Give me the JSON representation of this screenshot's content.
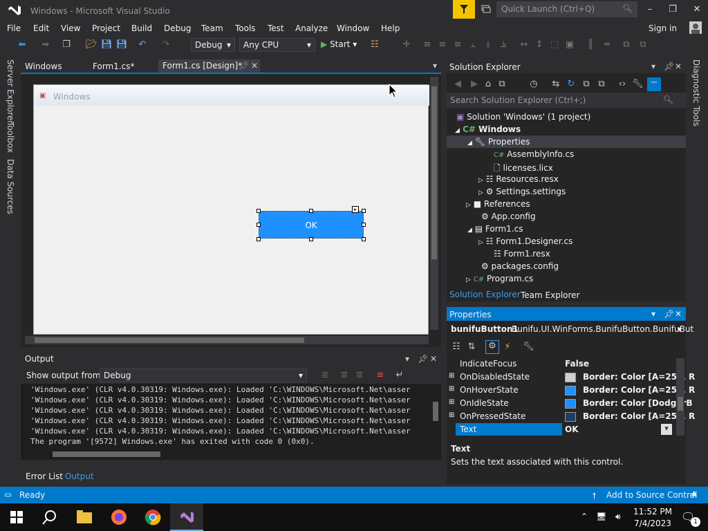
{
  "window": {
    "title": "Windows - Microsoft Visual Studio",
    "quick_launch_placeholder": "Quick Launch (Ctrl+Q)",
    "signin": "Sign in"
  },
  "menu": [
    "File",
    "Edit",
    "View",
    "Project",
    "Build",
    "Debug",
    "Team",
    "Tools",
    "Test",
    "Analyze",
    "Window",
    "Help"
  ],
  "toolbar": {
    "config": "Debug",
    "platform": "Any CPU",
    "start": "Start"
  },
  "leftrail": [
    "Server Explorer",
    "Toolbox",
    "Data Sources"
  ],
  "rightrail": "Diagnostic Tools",
  "doctabs": [
    "Windows",
    "Form1.cs*",
    "Form1.cs [Design]*"
  ],
  "designer": {
    "form_title": "Windows",
    "button_text": "OK"
  },
  "output": {
    "title": "Output",
    "show_from_label": "Show output from:",
    "show_from_value": "Debug",
    "lines": [
      "'Windows.exe' (CLR v4.0.30319: Windows.exe): Loaded 'C:\\WINDOWS\\Microsoft.Net\\asser",
      "'Windows.exe' (CLR v4.0.30319: Windows.exe): Loaded 'C:\\WINDOWS\\Microsoft.Net\\asser",
      "'Windows.exe' (CLR v4.0.30319: Windows.exe): Loaded 'C:\\WINDOWS\\Microsoft.Net\\asser",
      "'Windows.exe' (CLR v4.0.30319: Windows.exe): Loaded 'C:\\WINDOWS\\Microsoft.Net\\asser",
      "'Windows.exe' (CLR v4.0.30319: Windows.exe): Loaded 'C:\\WINDOWS\\Microsoft.Net\\asser",
      "The program '[9572] Windows.exe' has exited with code 0 (0x0)."
    ]
  },
  "bottomtabs": [
    "Error List",
    "Output"
  ],
  "solution_explorer": {
    "title": "Solution Explorer",
    "search_placeholder": "Search Solution Explorer (Ctrl+;)",
    "nodes": [
      {
        "label": "Solution 'Windows' (1 project)",
        "icon": "solution-icon"
      },
      {
        "label": "Windows",
        "icon": "csharp-project-icon"
      },
      {
        "label": "Properties",
        "icon": "wrench-icon"
      },
      {
        "label": "AssemblyInfo.cs",
        "icon": "csharp-file-icon"
      },
      {
        "label": "licenses.licx",
        "icon": "file-icon"
      },
      {
        "label": "Resources.resx",
        "icon": "resx-icon"
      },
      {
        "label": "Settings.settings",
        "icon": "gear-icon"
      },
      {
        "label": "References",
        "icon": "references-icon"
      },
      {
        "label": "App.config",
        "icon": "config-icon"
      },
      {
        "label": "Form1.cs",
        "icon": "form-icon"
      },
      {
        "label": "Form1.Designer.cs",
        "icon": "csharp-file-icon"
      },
      {
        "label": "Form1.resx",
        "icon": "resx-icon"
      },
      {
        "label": "packages.config",
        "icon": "config-icon"
      },
      {
        "label": "Program.cs",
        "icon": "csharp-file-icon"
      }
    ],
    "tabs": [
      "Solution Explorer",
      "Team Explorer"
    ]
  },
  "properties": {
    "title": "Properties",
    "object_name": "bunifuButton1",
    "object_type": "Bunifu.UI.WinForms.BunifuButton.BunifuBut",
    "rows": [
      {
        "name": "IndicateFocus",
        "value": "False"
      },
      {
        "name": "OnDisabledState",
        "value": "Border: Color [A=255, R",
        "swatch": "#d0d0d0"
      },
      {
        "name": "OnHoverState",
        "value": "Border: Color [A=255, R",
        "swatch": "#1e90ff"
      },
      {
        "name": "OnIdleState",
        "value": "Border: Color [DodgerB",
        "swatch": "#1e90ff"
      },
      {
        "name": "OnPressedState",
        "value": "Border: Color [A=255, R",
        "swatch": "#1f3f5f"
      },
      {
        "name": "Text",
        "value": "OK"
      }
    ],
    "desc_title": "Text",
    "desc_body": "Sets the text associated with this control."
  },
  "status": {
    "left": "Ready",
    "right": "Add to Source Control"
  },
  "taskbar": {
    "time": "11:52 PM",
    "date": "7/4/2023",
    "notifications": "1"
  }
}
